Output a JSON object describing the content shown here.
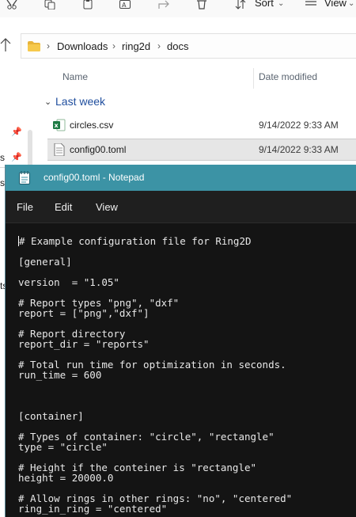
{
  "explorer": {
    "toolbar": {
      "sort_label": "Sort",
      "view_label": "View"
    },
    "breadcrumb": [
      "Downloads",
      "ring2d",
      "docs"
    ],
    "columns": {
      "name": "Name",
      "date_modified": "Date modified"
    },
    "group_label": "Last week",
    "files": [
      {
        "name": "circles.csv",
        "date": "9/14/2022 9:33 AM",
        "icon": "excel-csv-icon"
      },
      {
        "name": "config00.toml",
        "date": "9/14/2022 9:33 AM",
        "icon": "text-file-icon",
        "selected": true
      }
    ],
    "sidebar_clipped_letters": [
      "s",
      "s",
      "ts"
    ]
  },
  "notepad": {
    "title": "config00.toml - Notepad",
    "menu": [
      "File",
      "Edit",
      "View"
    ],
    "lines": [
      "# Example configuration file for Ring2D",
      "[general]",
      "version  = \"1.05\"",
      "# Report types \"png\", \"dxf\"",
      "report = [\"png\",\"dxf\"]",
      "# Report directory",
      "report_dir = \"reports\"",
      "# Total run time for optimization in seconds.",
      "run_time = 600",
      "[container]",
      "# Types of container: \"circle\", \"rectangle\"",
      "type = \"circle\"",
      "# Height if the conteiner is \"rectangle\"",
      "height = 20000.0",
      "# Allow rings in other rings: \"no\", \"centered\"",
      "ring_in_ring = \"centered\""
    ]
  },
  "colors": {
    "notepad_titlebar": "#3c93a5",
    "notepad_bg": "#141414",
    "explorer_group": "#1f4e9e",
    "selected_row": "#e6e6e6"
  }
}
